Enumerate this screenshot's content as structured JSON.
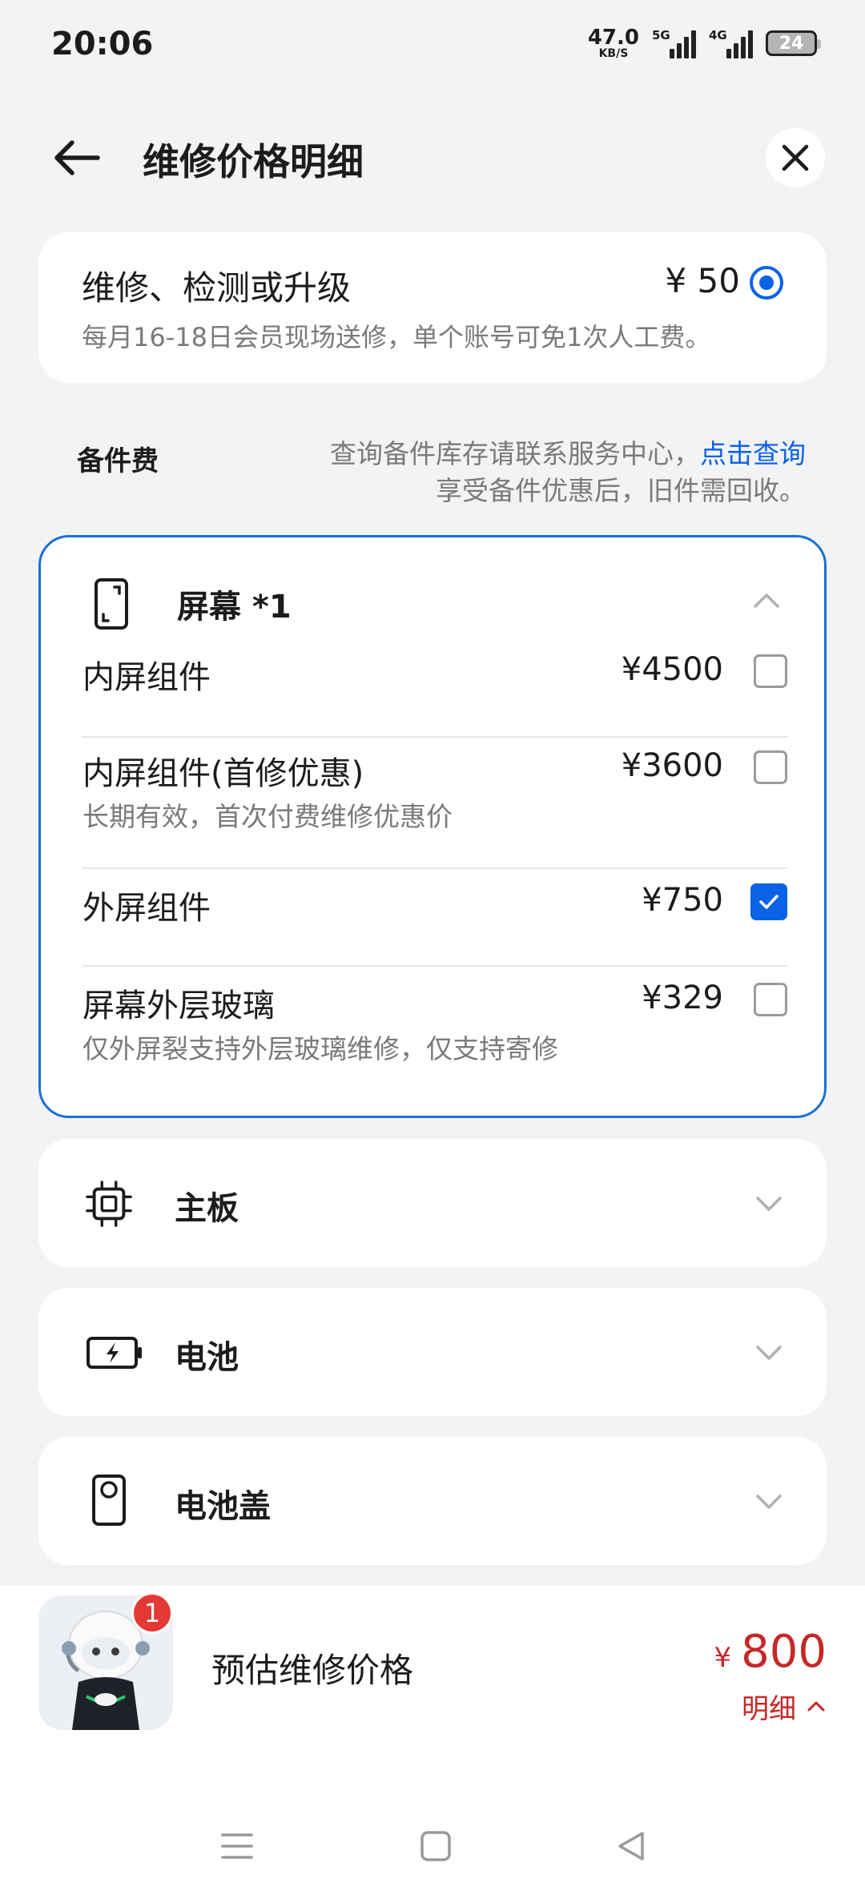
{
  "status": {
    "time": "20:06",
    "net_speed_value": "47.0",
    "net_speed_unit": "KB/S",
    "sim1_label": "5G",
    "sim2_label": "4G",
    "battery": "24"
  },
  "header": {
    "title": "维修价格明细",
    "back_icon": "arrow-left-icon",
    "close_icon": "close-icon"
  },
  "service": {
    "name": "维修、检测或升级",
    "price": "¥ 50",
    "desc": "每月16-18日会员现场送修，单个账号可免1次人工费。",
    "selected": true
  },
  "parts": {
    "label": "备件费",
    "note_line1": "查询备件库存请联系服务中心，",
    "note_link": "点击查询",
    "note_line2": "享受备件优惠后，旧件需回收。"
  },
  "categories": [
    {
      "name": "屏幕 *1",
      "icon": "phone-screen-icon",
      "expanded": true,
      "items": [
        {
          "name": "内屏组件",
          "price": "¥4500",
          "desc": "",
          "checked": false
        },
        {
          "name": "内屏组件(首修优惠)",
          "price": "¥3600",
          "desc": "长期有效，首次付费维修优惠价",
          "checked": false
        },
        {
          "name": "外屏组件",
          "price": "¥750",
          "desc": "",
          "checked": true
        },
        {
          "name": "屏幕外层玻璃",
          "price": "¥329",
          "desc": "仅外屏裂支持外层玻璃维修，仅支持寄修",
          "checked": false
        }
      ]
    },
    {
      "name": "主板",
      "icon": "chip-icon",
      "expanded": false
    },
    {
      "name": "电池",
      "icon": "battery-charging-icon",
      "expanded": false
    },
    {
      "name": "电池盖",
      "icon": "phone-back-camera-icon",
      "expanded": false
    }
  ],
  "summary": {
    "badge": "1",
    "label": "预估维修价格",
    "currency": "¥",
    "amount": "800",
    "detail": "明细"
  },
  "colors": {
    "accent": "#0a62e6",
    "price_red": "#c62828",
    "background": "#f2f3f5"
  }
}
